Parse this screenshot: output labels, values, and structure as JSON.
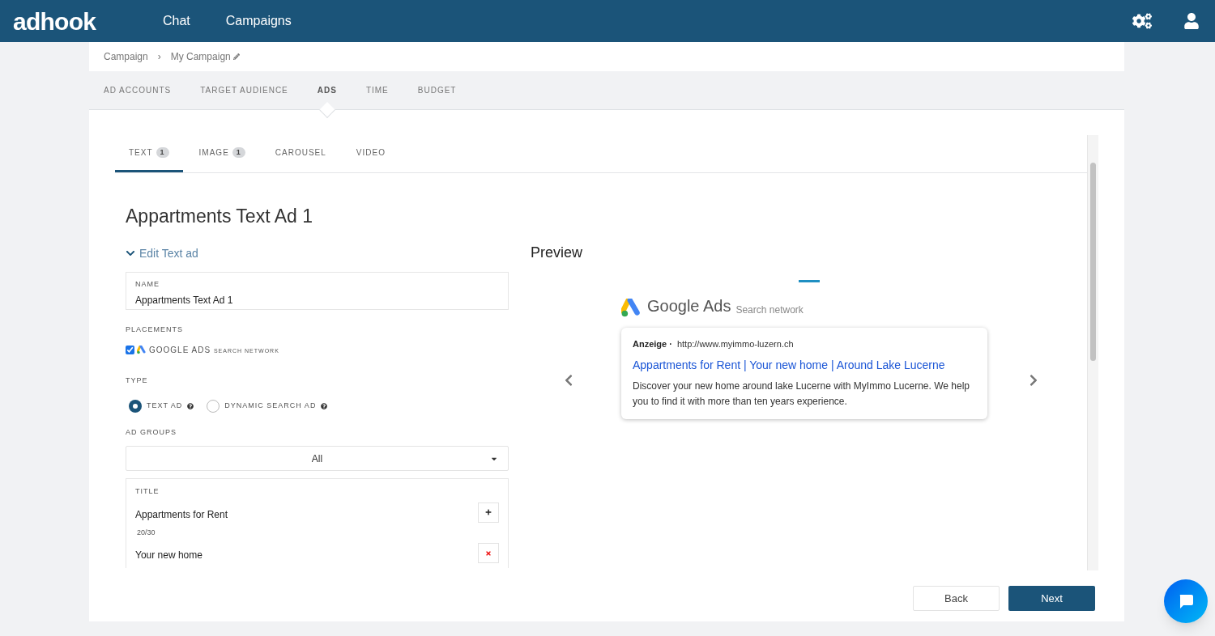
{
  "header": {
    "logo": "adhook",
    "nav": [
      {
        "label": "Chat",
        "selected": false
      },
      {
        "label": "Campaigns",
        "selected": false
      }
    ]
  },
  "breadcrumb": [
    "Campaign",
    "›",
    "My Campaign"
  ],
  "steps": [
    {
      "label": "AD ACCOUNTS",
      "selected": false
    },
    {
      "label": "TARGET AUDIENCE",
      "selected": false
    },
    {
      "label": "ADS",
      "selected": true
    },
    {
      "label": "TIME",
      "selected": false
    },
    {
      "label": "BUDGET",
      "selected": false
    }
  ],
  "ad_tabs": [
    {
      "label": "TEXT",
      "count": "1",
      "selected": true
    },
    {
      "label": "IMAGE",
      "count": "1",
      "selected": false
    },
    {
      "label": "CAROUSEL",
      "selected": false
    },
    {
      "label": "VIDEO",
      "selected": false
    }
  ],
  "ad_title": "Appartments Text Ad 1",
  "edit_toggle": {
    "label": "Edit Text ad",
    "expanded": true
  },
  "name_field": {
    "label": "NAME",
    "value": "Appartments Text Ad 1"
  },
  "placements": {
    "label": "PLACEMENTS",
    "items": [
      {
        "label": "GOOGLE ADS",
        "sub": "SEARCH NETWORK",
        "checked": true
      }
    ]
  },
  "type": {
    "label": "TYPE",
    "options": [
      {
        "label": "TEXT AD",
        "selected": true
      },
      {
        "label": "DYNAMIC SEARCH AD",
        "selected": false
      }
    ]
  },
  "ad_groups": {
    "label": "AD GROUPS",
    "value": "All"
  },
  "titles": {
    "label": "TITLE",
    "items": [
      {
        "text": "Appartments for Rent",
        "count": "20/30",
        "kind": "add"
      },
      {
        "text": "Your new home",
        "kind": "remove"
      }
    ]
  },
  "preview": {
    "heading": "Preview",
    "brand": "Google Ads",
    "network": "Search network",
    "ad_label": "Anzeige ·",
    "url": "http://www.myimmo-luzern.ch",
    "headline": "Appartments for Rent | Your new home | Around Lake Lucerne",
    "description": "Discover your new home around lake Lucerne with MyImmo Lucerne. We help you to find it with more than ten years experience."
  },
  "buttons": [
    {
      "label": "Back",
      "kind": "secondary"
    },
    {
      "label": "Next",
      "kind": "primary"
    }
  ]
}
